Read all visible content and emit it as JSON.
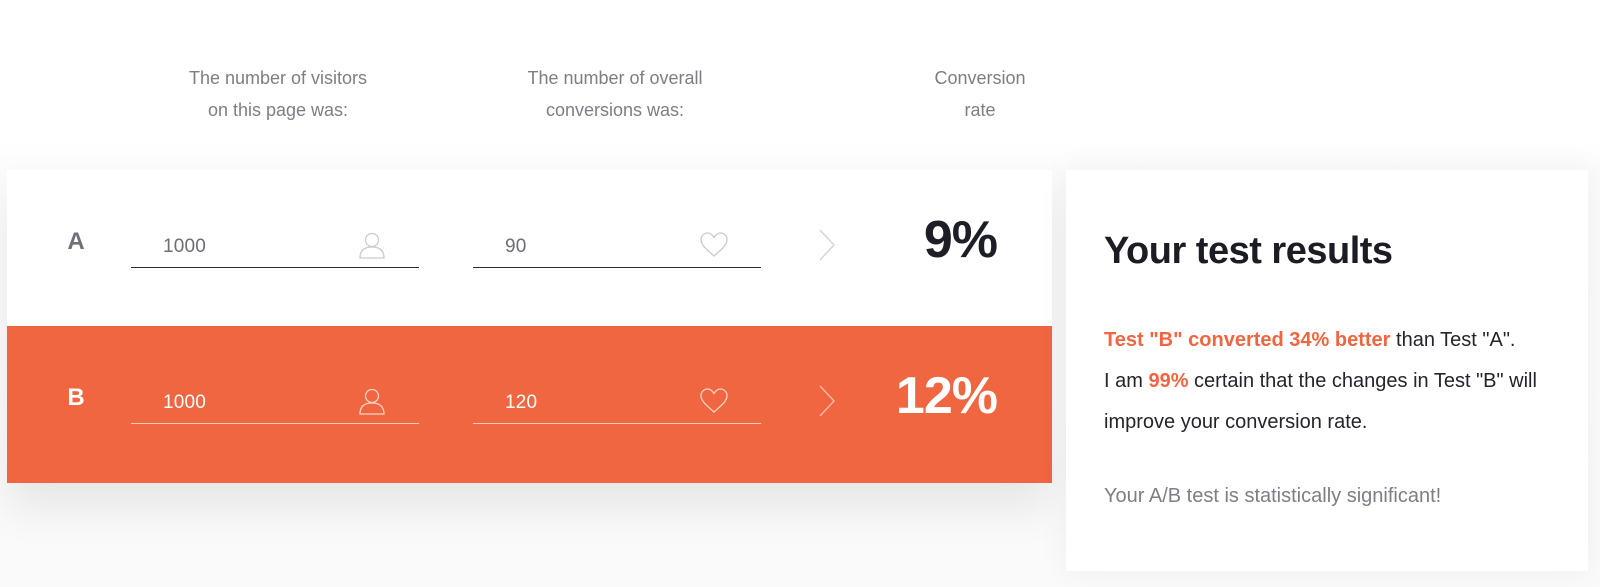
{
  "headers": {
    "visitors": [
      "The number of visitors",
      "on this page was:"
    ],
    "conversions": [
      "The number of overall",
      "conversions was:"
    ],
    "rate": [
      "Conversion",
      "rate"
    ]
  },
  "variants": [
    {
      "label": "A",
      "visitors": "1000",
      "conversions": "90",
      "rate": "9%"
    },
    {
      "label": "B",
      "visitors": "1000",
      "conversions": "120",
      "rate": "12%"
    }
  ],
  "results": {
    "title": "Your test results",
    "line1_accent": "Test \"B\" converted 34% better",
    "line1_rest": " than Test \"A\".",
    "line2_pre": "I am ",
    "line2_accent": "99%",
    "line2_post": " certain that the changes in Test \"B\" will improve your conversion rate.",
    "significance": "Your A/B test is statistically significant!"
  },
  "icons": {
    "visitors": "user-icon",
    "conversions": "heart-icon",
    "arrow": "chevron-right-icon"
  },
  "colors": {
    "accent": "#ef6640",
    "text_dark": "#1d1e26",
    "text_muted": "#7d7e86"
  }
}
